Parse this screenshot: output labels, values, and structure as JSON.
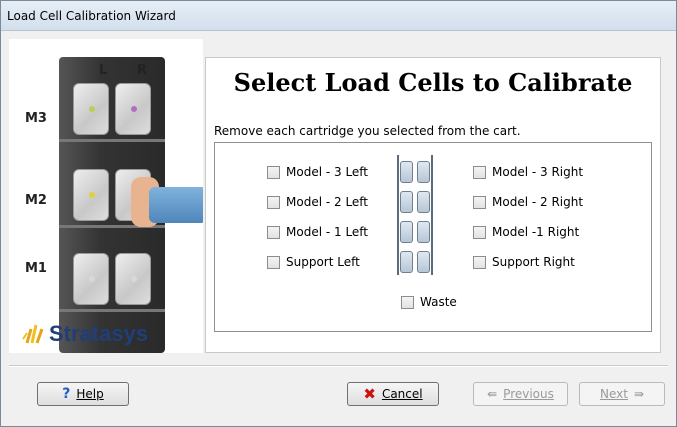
{
  "window": {
    "title": "Load Cell Calibration Wizard"
  },
  "left_panel": {
    "column_labels": [
      "L",
      "R"
    ],
    "row_labels": [
      "M3",
      "M2",
      "M1"
    ],
    "brand": "Stratasys"
  },
  "main": {
    "heading": "Select Load Cells to Calibrate",
    "instruction": "Remove each cartridge you selected from the cart.",
    "left_checkboxes": [
      {
        "label": "Model - 3 Left",
        "checked": false
      },
      {
        "label": "Model - 2 Left",
        "checked": false
      },
      {
        "label": "Model - 1 Left",
        "checked": false
      },
      {
        "label": "Support Left",
        "checked": false
      }
    ],
    "right_checkboxes": [
      {
        "label": "Model - 3 Right",
        "checked": false
      },
      {
        "label": "Model - 2 Right",
        "checked": false
      },
      {
        "label": "Model -1 Right",
        "checked": false
      },
      {
        "label": "Support Right",
        "checked": false
      }
    ],
    "waste_checkbox": {
      "label": "Waste",
      "checked": false
    }
  },
  "buttons": {
    "help": {
      "label": "Help",
      "icon": "question-icon",
      "enabled": true
    },
    "cancel": {
      "label": "Cancel",
      "icon": "red-x-icon",
      "enabled": true
    },
    "previous": {
      "label": "Previous",
      "icon": "left-arrow-icon",
      "enabled": false
    },
    "next": {
      "label": "Next",
      "icon": "right-arrow-icon",
      "enabled": false
    }
  },
  "colors": {
    "cancel_icon": "#cc1111",
    "brand_text": "#1f3e7a",
    "help_icon": "#1f5fbf"
  }
}
